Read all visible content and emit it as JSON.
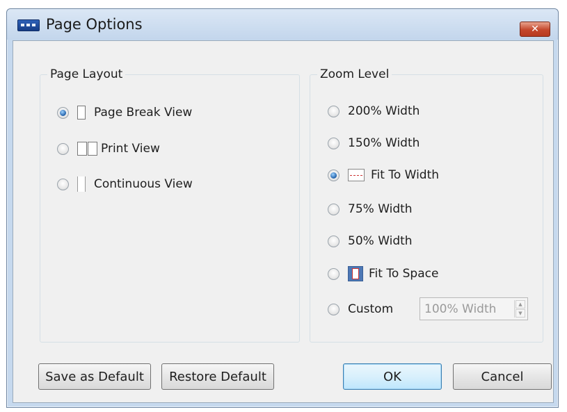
{
  "window": {
    "title": "Page Options",
    "close_glyph": "✕"
  },
  "page_layout": {
    "legend": "Page Layout",
    "options": [
      {
        "label": "Page Break View",
        "checked": true,
        "icon": "page-break-icon"
      },
      {
        "label": "Print View",
        "checked": false,
        "icon": "print-view-icon"
      },
      {
        "label": "Continuous View",
        "checked": false,
        "icon": "continuous-view-icon"
      }
    ]
  },
  "zoom_level": {
    "legend": "Zoom Level",
    "options": [
      {
        "label": "200% Width",
        "checked": false
      },
      {
        "label": "150% Width",
        "checked": false
      },
      {
        "label": "Fit To Width",
        "checked": true,
        "icon": "fit-to-width-icon"
      },
      {
        "label": "75% Width",
        "checked": false
      },
      {
        "label": "50% Width",
        "checked": false
      },
      {
        "label": "Fit To Space",
        "checked": false,
        "icon": "fit-to-space-icon"
      },
      {
        "label": "Custom",
        "checked": false
      }
    ],
    "custom_value": "100% Width"
  },
  "buttons": {
    "save_default": "Save as Default",
    "restore_default": "Restore Default",
    "ok": "OK",
    "cancel": "Cancel"
  }
}
